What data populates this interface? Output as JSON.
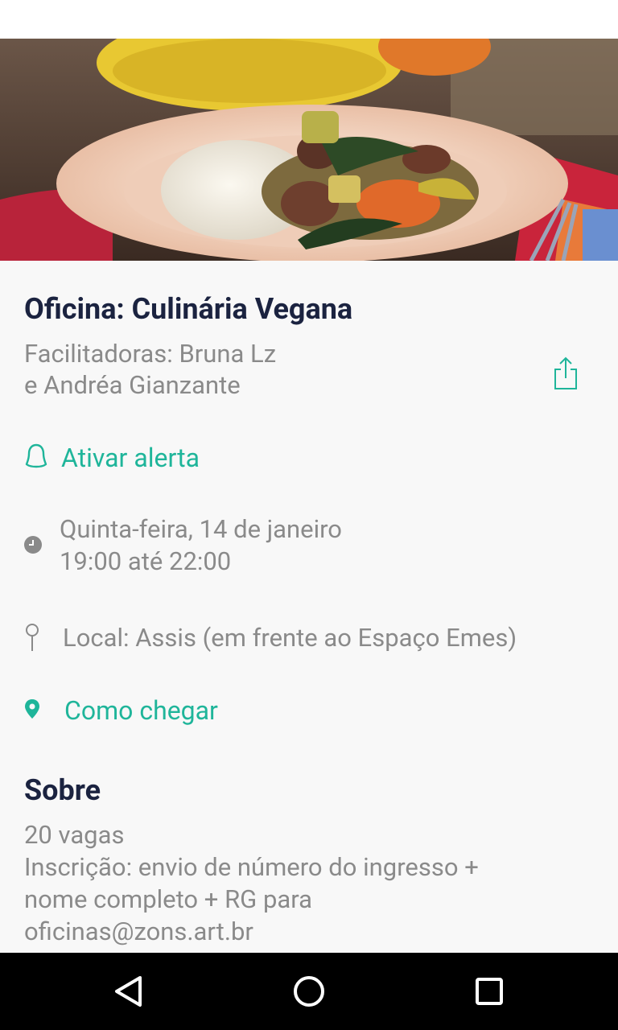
{
  "event": {
    "title": "Oficina: Culinária Vegana",
    "facilitators": [
      "Facilitadoras: Bruna Lz",
      "e Andréa Gianzante"
    ],
    "alert_label": "Ativar alerta",
    "date_line": "Quinta-feira, 14 de janeiro",
    "time_line": "19:00 até 22:00",
    "location": "Local: Assis (em frente ao Espaço Emes)",
    "directions_label": "Como chegar"
  },
  "about": {
    "heading": "Sobre",
    "lines": [
      "20 vagas",
      "Inscrição: envio de número do ingresso +",
      "nome completo + RG para",
      "oficinas@zons.art.br"
    ]
  },
  "hero_image": {
    "subject": "plate of rice with vegetable stew",
    "icon": "food-photo"
  },
  "icons": {
    "share": "share-icon",
    "alert": "bell-icon",
    "clock": "clock-icon",
    "location": "pin-outline-icon",
    "directions": "map-pin-icon",
    "nav": [
      "back-triangle-icon",
      "home-circle-icon",
      "recents-square-icon"
    ]
  },
  "colors": {
    "accent": "#1fb59a",
    "title": "#1b2340",
    "secondary_text": "#8a8a8a",
    "background": "#f8f8f8"
  }
}
